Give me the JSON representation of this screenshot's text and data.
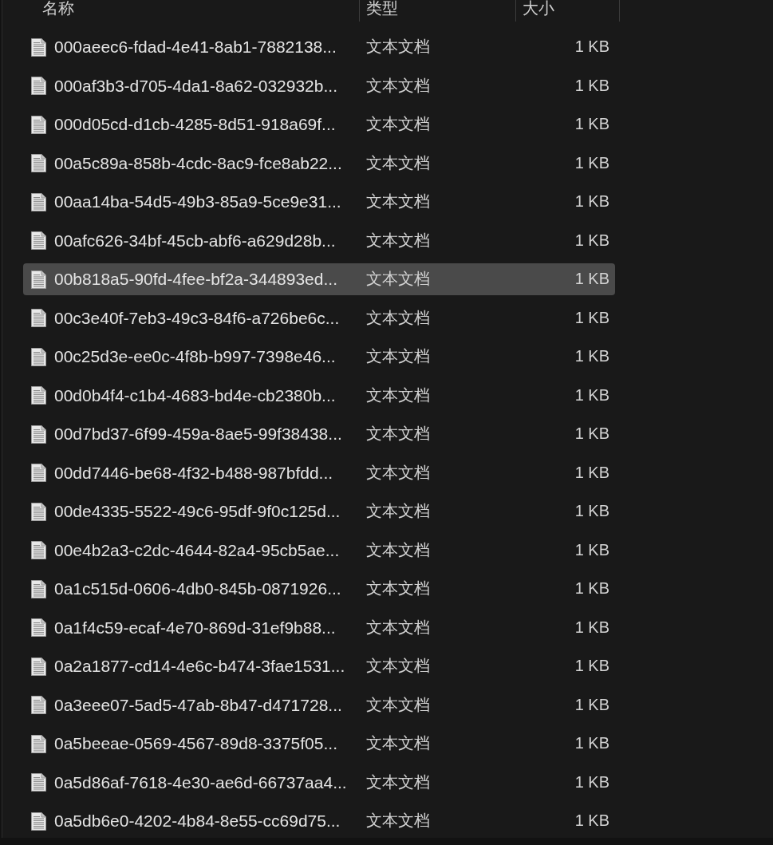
{
  "columns": [
    {
      "label": "名称"
    },
    {
      "label": "类型"
    },
    {
      "label": "大小"
    }
  ],
  "files": [
    {
      "name": "000aeec6-fdad-4e41-8ab1-7882138...",
      "type": "文本文档",
      "size": "1 KB",
      "selected": false
    },
    {
      "name": "000af3b3-d705-4da1-8a62-032932b...",
      "type": "文本文档",
      "size": "1 KB",
      "selected": false
    },
    {
      "name": "000d05cd-d1cb-4285-8d51-918a69f...",
      "type": "文本文档",
      "size": "1 KB",
      "selected": false
    },
    {
      "name": "00a5c89a-858b-4cdc-8ac9-fce8ab22...",
      "type": "文本文档",
      "size": "1 KB",
      "selected": false
    },
    {
      "name": "00aa14ba-54d5-49b3-85a9-5ce9e31...",
      "type": "文本文档",
      "size": "1 KB",
      "selected": false
    },
    {
      "name": "00afc626-34bf-45cb-abf6-a629d28b...",
      "type": "文本文档",
      "size": "1 KB",
      "selected": false
    },
    {
      "name": "00b818a5-90fd-4fee-bf2a-344893ed...",
      "type": "文本文档",
      "size": "1 KB",
      "selected": true
    },
    {
      "name": "00c3e40f-7eb3-49c3-84f6-a726be6c...",
      "type": "文本文档",
      "size": "1 KB",
      "selected": false
    },
    {
      "name": "00c25d3e-ee0c-4f8b-b997-7398e46...",
      "type": "文本文档",
      "size": "1 KB",
      "selected": false
    },
    {
      "name": "00d0b4f4-c1b4-4683-bd4e-cb2380b...",
      "type": "文本文档",
      "size": "1 KB",
      "selected": false
    },
    {
      "name": "00d7bd37-6f99-459a-8ae5-99f38438...",
      "type": "文本文档",
      "size": "1 KB",
      "selected": false
    },
    {
      "name": "00dd7446-be68-4f32-b488-987bfdd...",
      "type": "文本文档",
      "size": "1 KB",
      "selected": false
    },
    {
      "name": "00de4335-5522-49c6-95df-9f0c125d...",
      "type": "文本文档",
      "size": "1 KB",
      "selected": false
    },
    {
      "name": "00e4b2a3-c2dc-4644-82a4-95cb5ae...",
      "type": "文本文档",
      "size": "1 KB",
      "selected": false
    },
    {
      "name": "0a1c515d-0606-4db0-845b-0871926...",
      "type": "文本文档",
      "size": "1 KB",
      "selected": false
    },
    {
      "name": "0a1f4c59-ecaf-4e70-869d-31ef9b88...",
      "type": "文本文档",
      "size": "1 KB",
      "selected": false
    },
    {
      "name": "0a2a1877-cd14-4e6c-b474-3fae1531...",
      "type": "文本文档",
      "size": "1 KB",
      "selected": false
    },
    {
      "name": "0a3eee07-5ad5-47ab-8b47-d471728...",
      "type": "文本文档",
      "size": "1 KB",
      "selected": false
    },
    {
      "name": "0a5beeae-0569-4567-89d8-3375f05...",
      "type": "文本文档",
      "size": "1 KB",
      "selected": false
    },
    {
      "name": "0a5d86af-7618-4e30-ae6d-66737aa4...",
      "type": "文本文档",
      "size": "1 KB",
      "selected": false
    },
    {
      "name": "0a5db6e0-4202-4b84-8e55-cc69d75...",
      "type": "文本文档",
      "size": "1 KB",
      "selected": false
    }
  ]
}
